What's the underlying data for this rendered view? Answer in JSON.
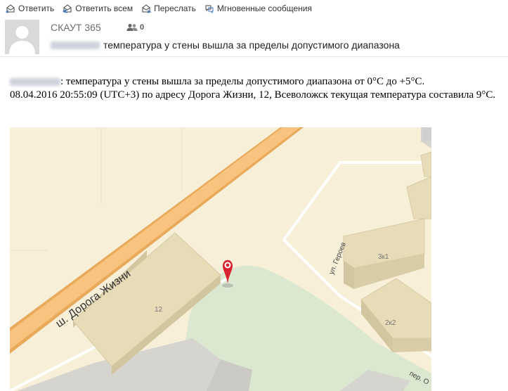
{
  "toolbar": {
    "reply": "Ответить",
    "reply_all": "Ответить всем",
    "forward": "Переслать",
    "instant_messages": "Мгновенные сообщения"
  },
  "header": {
    "sender": "СКАУТ 365",
    "people_count": "0",
    "subject": "температура у стены вышла за пределы допустимого диапазона"
  },
  "body": {
    "line1": ": температура у стены вышла за пределы допустимого диапазона от 0°C до +5°C.",
    "line2": "08.04.2016 20:55:09 (UTC+3) по адресу Дорога Жизни, 12, Всеволожск текущая температура составила 9°C."
  },
  "map": {
    "road_label": "ш. Дорога Жизни",
    "street_label": "ул. Героев",
    "street_label_2": "пер. О",
    "building_1": "12",
    "building_2": "3к1",
    "building_3": "2к2"
  },
  "colors": {
    "map_bg": "#f7efd8",
    "road_orange": "#f8c37f",
    "building": "#e8dcb8",
    "park": "#dbe8cf",
    "marker": "#d9232e"
  }
}
